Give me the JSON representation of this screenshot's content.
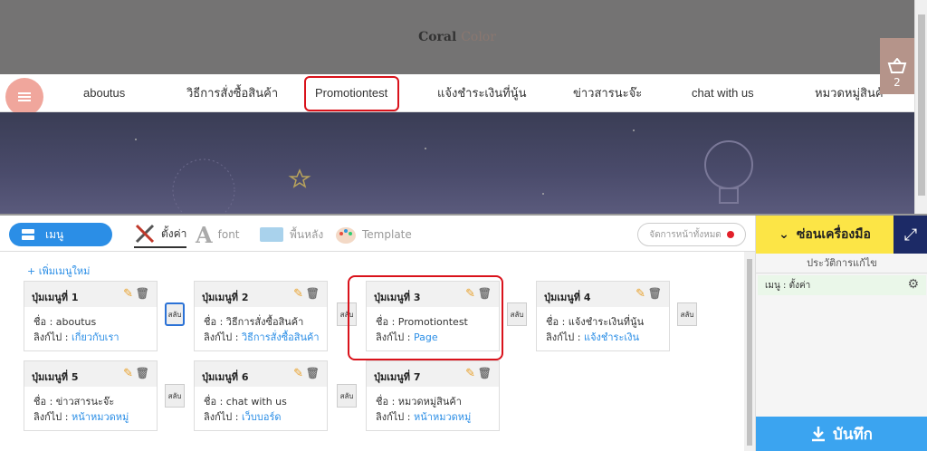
{
  "site": {
    "logo_part1": "Coral",
    "logo_part2": "Color",
    "nav": [
      "aboutus",
      "วิธีการสั่งซื้อสินค้า",
      "Promotiontest",
      "แจ้งชำระเงินที่นู้น",
      "ข่าวสารนะจ๊ะ",
      "chat with us",
      "หมวดหมู่สินค้"
    ],
    "cart_count": "2"
  },
  "toolbar": {
    "menu_label": "เมนู",
    "tabs": [
      "ตั้งค่า",
      "font",
      "พื้นหลัง",
      "Template"
    ],
    "all_pages": "จัดการหน้าทั้งหมด"
  },
  "menu_editor": {
    "add_label": "+ เพิ่มเมนูใหม่",
    "name_prefix": "ชื่อ :",
    "link_prefix": "ลิงก์ไป :",
    "swap_label": "สลับ",
    "cards": [
      {
        "title": "ปุ่มเมนูที่ 1",
        "name": "aboutus",
        "link": "เกี่ยวกับเรา"
      },
      {
        "title": "ปุ่มเมนูที่ 2",
        "name": "วิธีการสั่งซื้อสินค้า",
        "link": "วิธีการสั่งซื้อสินค้า"
      },
      {
        "title": "ปุ่มเมนูที่ 3",
        "name": "Promotiontest",
        "link": "Page"
      },
      {
        "title": "ปุ่มเมนูที่ 4",
        "name": "แจ้งชำระเงินที่นู้น",
        "link": "แจ้งชำระเงิน"
      },
      {
        "title": "ปุ่มเมนูที่ 5",
        "name": "ข่าวสารนะจ๊ะ",
        "link": "หน้าหมวดหมู่"
      },
      {
        "title": "ปุ่มเมนูที่ 6",
        "name": "chat with us",
        "link": "เว็บบอร์ด"
      },
      {
        "title": "ปุ่มเมนูที่ 7",
        "name": "หมวดหมู่สินค้า",
        "link": "หน้าหมวดหมู่"
      }
    ]
  },
  "sidebar": {
    "hide_tools": "ซ่อนเครื่องมือ",
    "history_title": "ประวัติการแก้ไข",
    "history_item": "เมนู : ตั้งค่า",
    "save_label": "บันทึก"
  },
  "colors": {
    "accent": "#2b8ee6",
    "highlight": "#d9121b",
    "save": "#3ba4f0",
    "hide_tools": "#fce546"
  }
}
